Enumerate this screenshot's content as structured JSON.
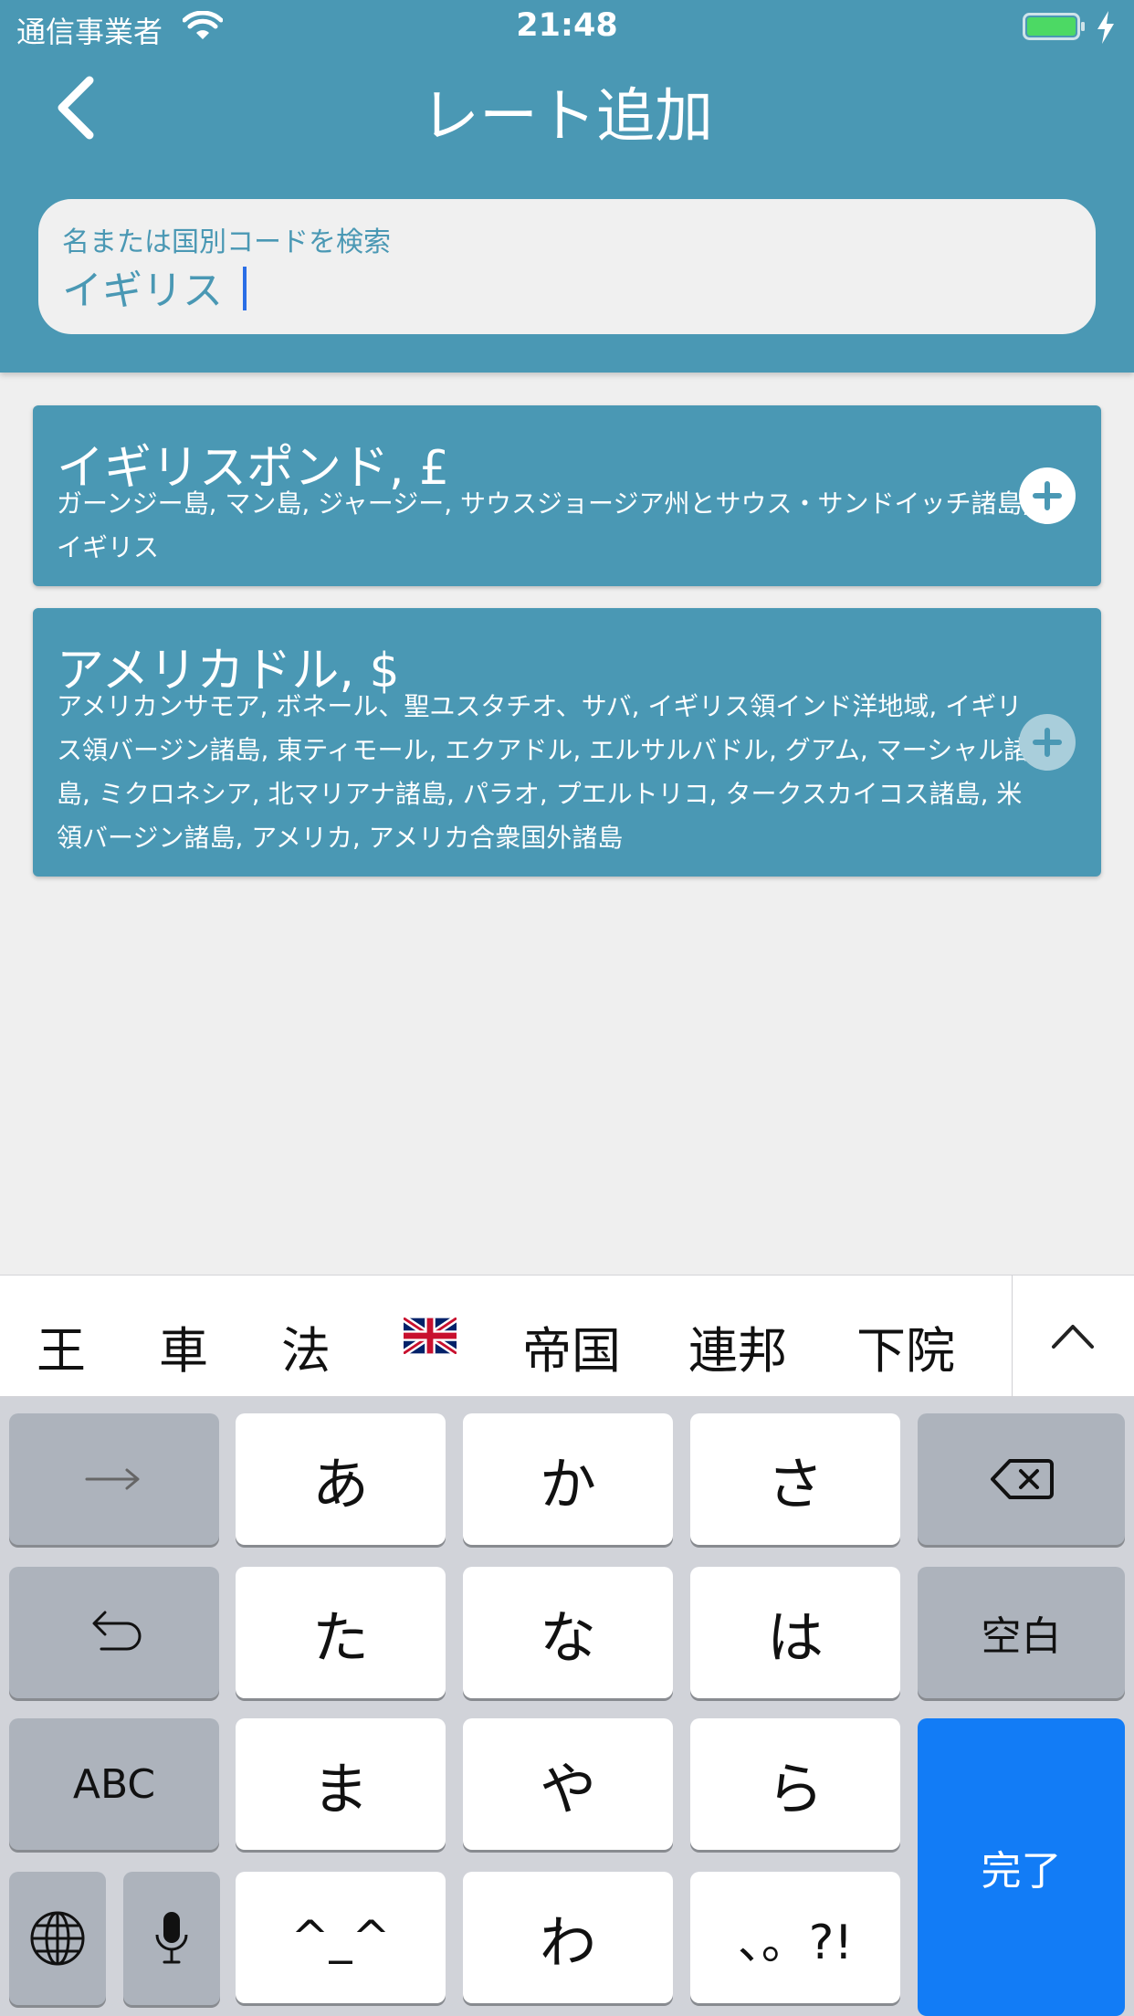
{
  "status_bar": {
    "carrier": "通信事業者",
    "time": "21:48"
  },
  "nav": {
    "title": "レート追加"
  },
  "search": {
    "label": "名または国別コードを検索",
    "value": "イギリス"
  },
  "results": [
    {
      "title": "イギリスポンド, £",
      "countries": "ガーンジー島, マン島, ジャージー, サウスジョージア州とサウス・サンドイッチ諸島, イギリス",
      "add_icon": "plus-circle-icon"
    },
    {
      "title": "アメリカドル, $",
      "countries": "アメリカンサモア, ボネール、聖ユスタチオ、サバ, イギリス領インド洋地域, イギリス領バージン諸島, 東ティモール, エクアドル, エルサルバドル, グアム, マーシャル諸島, ミクロネシア, 北マリアナ諸島, パラオ, プエルトリコ, タークスカイコス諸島, 米領バージン諸島, アメリカ, アメリカ合衆国外諸島",
      "add_icon": "plus-circle-icon"
    }
  ],
  "candidates": [
    "王",
    "車",
    "法",
    "帝国",
    "連邦",
    "下院"
  ],
  "candidate_flag": "uk-flag-emoji",
  "keyboard": {
    "row1": [
      "あ",
      "か",
      "さ"
    ],
    "row2": [
      "た",
      "な",
      "は"
    ],
    "row3": [
      "ま",
      "や",
      "ら"
    ],
    "row4": [
      "^_^",
      "わ",
      "、。?!"
    ],
    "space": "空白",
    "abc": "ABC",
    "done": "完了"
  },
  "colors": {
    "header": "#4a98b4",
    "background": "#efefef",
    "keyboard": "#d1d3d9",
    "done_key": "#127cf6"
  }
}
